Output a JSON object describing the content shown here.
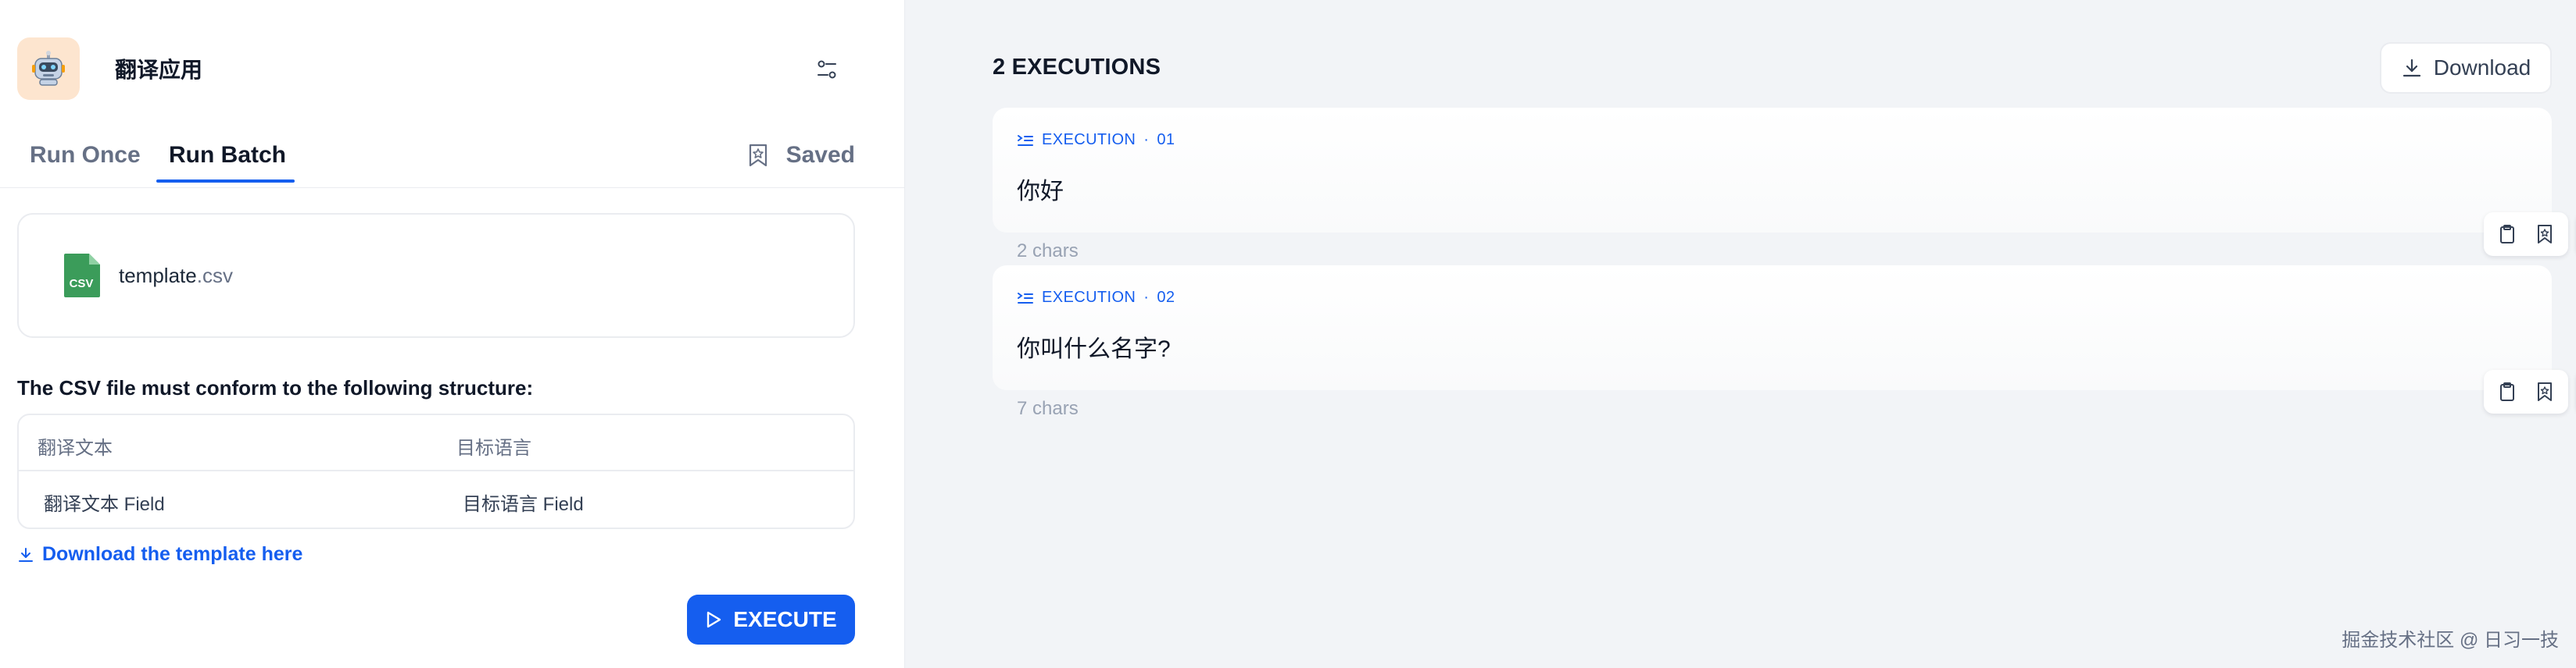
{
  "app": {
    "title": "翻译应用",
    "icon": "robot-emoji-icon",
    "accent_color": "#155eef"
  },
  "tabs": [
    {
      "label": "Run Once",
      "active": false
    },
    {
      "label": "Run Batch",
      "active": true
    }
  ],
  "saved_label": "Saved",
  "file": {
    "name": "template",
    "ext": ".csv",
    "icon_text": "CSV"
  },
  "csv_note": "The CSV file must conform to the following structure:",
  "csv_table": {
    "headers": [
      "翻译文本",
      "目标语言"
    ],
    "row": [
      "翻译文本 Field",
      "目标语言 Field"
    ]
  },
  "download_template_label": "Download the template here",
  "execute_label": "EXECUTE",
  "results": {
    "title": "2 EXECUTIONS",
    "download_label": "Download",
    "executions": [
      {
        "label": "EXECUTION",
        "index": "01",
        "text": "你好",
        "chars": "2 chars"
      },
      {
        "label": "EXECUTION",
        "index": "02",
        "text": "你叫什么名字?",
        "chars": "7 chars"
      }
    ]
  },
  "watermark": "掘金技术社区 @ 日习一技"
}
